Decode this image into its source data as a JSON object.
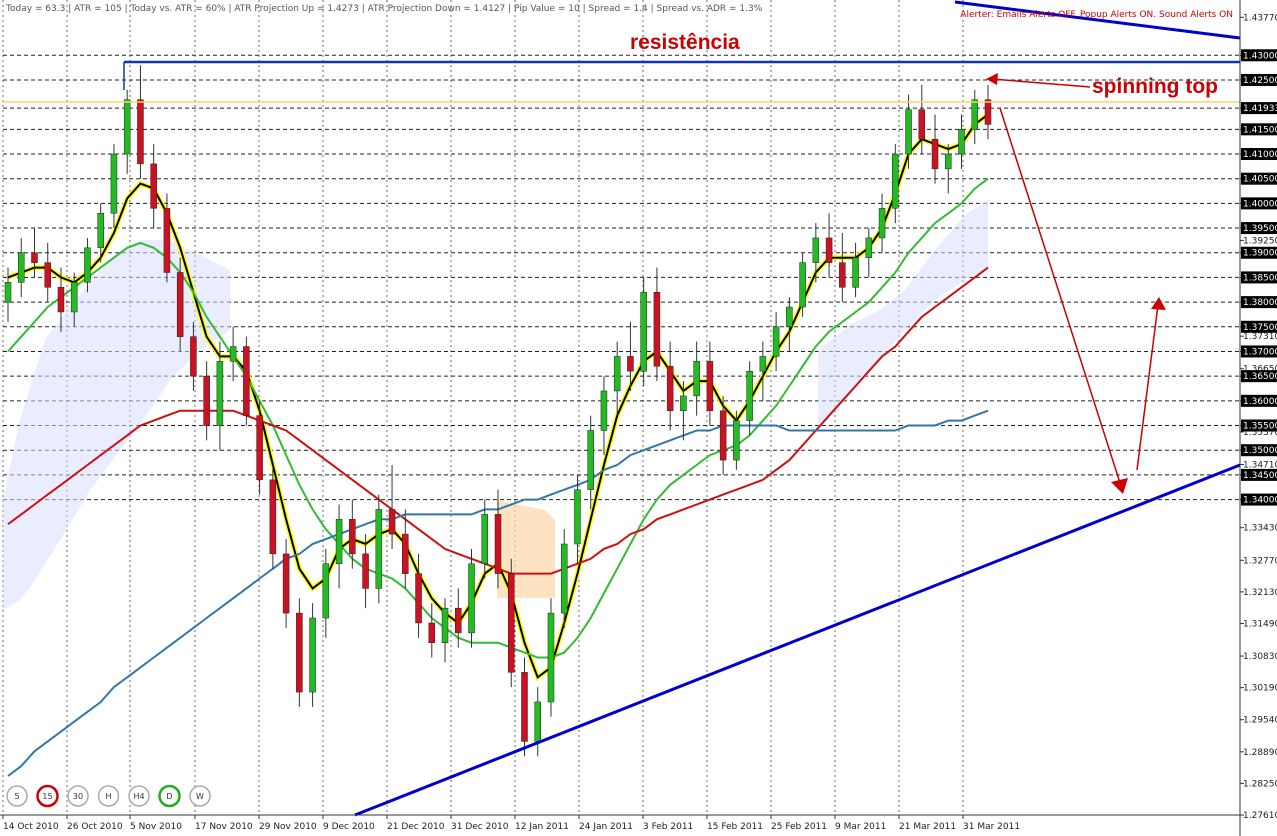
{
  "info_bar": {
    "items": [
      "Today = 63.3",
      "ATR = 105",
      "Today vs. ATR = 60%",
      "ATR Projection Up = 1.4273",
      "ATR Projection Down = 1.4127",
      "Pip Value = 10",
      "Spread = 1.4",
      "Spread vs. ADR = 1.3%"
    ],
    "alerter": "Alerter: Emails Alerts OFF. Popup Alerts ON. Sound Alerts ON"
  },
  "annotations": {
    "resistance": "resistência",
    "spinning_top": "spinning top"
  },
  "timeframes": [
    {
      "label": "5",
      "active": false
    },
    {
      "label": "15",
      "active": true,
      "color": "#cc0000"
    },
    {
      "label": "30",
      "active": false
    },
    {
      "label": "H",
      "active": false
    },
    {
      "label": "H4",
      "active": false
    },
    {
      "label": "D",
      "active": true,
      "color": "#22aa22"
    },
    {
      "label": "W",
      "active": false
    }
  ],
  "colors": {
    "bull": "#22bb22",
    "bear": "#cc1122",
    "ma_fast": "#000000",
    "ma_fast_band": "#ffff00",
    "ma_green": "#33bb33",
    "ma_red": "#cc1111",
    "ma_blue": "#3377aa",
    "trendline": "#0000cc",
    "arrow": "#cc0000",
    "resistance_line": "#1133bb",
    "price_line": "#f5d26e"
  },
  "chart_data": {
    "type": "candlestick",
    "symbol_pair": "EUR/USD",
    "timeframe": "D",
    "title": "",
    "ylim": [
      1.2761,
      1.4412
    ],
    "y_ticks": [
      1.4377,
      1.43,
      1.425,
      1.4193,
      1.415,
      1.41,
      1.405,
      1.4,
      1.395,
      1.3925,
      1.39,
      1.385,
      1.38,
      1.375,
      1.3731,
      1.37,
      1.3665,
      1.365,
      1.36,
      1.355,
      1.3537,
      1.35,
      1.3471,
      1.345,
      1.34,
      1.3343,
      1.3277,
      1.3213,
      1.3149,
      1.3083,
      1.3019,
      1.2954,
      1.2889,
      1.2825,
      1.2761
    ],
    "y_tick_labels": [
      "1.43770",
      "1.43000",
      "1.42500",
      "1.41933",
      "1.41500",
      "1.41000",
      "1.40500",
      "1.40000",
      "1.39500",
      "1.39250",
      "1.39000",
      "1.38500",
      "1.38000",
      "1.37500",
      "1.37310",
      "1.37000",
      "1.36650",
      "1.36500",
      "1.36000",
      "1.35500",
      "1.35370",
      "1.35000",
      "1.34710",
      "1.34500",
      "1.34000",
      "1.33430",
      "1.32770",
      "1.32130",
      "1.31490",
      "1.30830",
      "1.30190",
      "1.29540",
      "1.28890",
      "1.28250",
      "1.27610"
    ],
    "highlighted_levels": [
      "1.43000",
      "1.42500",
      "1.41933",
      "1.41500",
      "1.41000",
      "1.40500",
      "1.40000",
      "1.39500",
      "1.39000",
      "1.38500",
      "1.38000",
      "1.37500",
      "1.37000",
      "1.36500",
      "1.36000",
      "1.35500",
      "1.35000",
      "1.34500",
      "1.34000"
    ],
    "x_labels": [
      "14 Oct 2010",
      "26 Oct 2010",
      "5 Nov 2010",
      "17 Nov 2010",
      "29 Nov 2010",
      "9 Dec 2010",
      "21 Dec 2010",
      "31 Dec 2010",
      "12 Jan 2011",
      "24 Jan 2011",
      "3 Feb 2011",
      "15 Feb 2011",
      "25 Feb 2011",
      "9 Mar 2011",
      "21 Mar 2011",
      "31 Mar 2011"
    ],
    "resistance_level": 1.4285,
    "current_price": 1.41933,
    "candles": [
      [
        1.38,
        1.387,
        1.376,
        1.384
      ],
      [
        1.384,
        1.393,
        1.381,
        1.39
      ],
      [
        1.39,
        1.395,
        1.385,
        1.388
      ],
      [
        1.388,
        1.392,
        1.38,
        1.383
      ],
      [
        1.383,
        1.387,
        1.374,
        1.378
      ],
      [
        1.378,
        1.386,
        1.375,
        1.384
      ],
      [
        1.384,
        1.393,
        1.382,
        1.391
      ],
      [
        1.391,
        1.4,
        1.388,
        1.398
      ],
      [
        1.398,
        1.412,
        1.395,
        1.41
      ],
      [
        1.41,
        1.423,
        1.406,
        1.421
      ],
      [
        1.421,
        1.428,
        1.405,
        1.408
      ],
      [
        1.408,
        1.412,
        1.395,
        1.399
      ],
      [
        1.399,
        1.402,
        1.384,
        1.386
      ],
      [
        1.386,
        1.389,
        1.37,
        1.373
      ],
      [
        1.373,
        1.376,
        1.362,
        1.365
      ],
      [
        1.365,
        1.368,
        1.352,
        1.355
      ],
      [
        1.355,
        1.372,
        1.35,
        1.368
      ],
      [
        1.368,
        1.375,
        1.364,
        1.371
      ],
      [
        1.371,
        1.373,
        1.355,
        1.357
      ],
      [
        1.357,
        1.36,
        1.341,
        1.344
      ],
      [
        1.344,
        1.347,
        1.326,
        1.329
      ],
      [
        1.329,
        1.332,
        1.314,
        1.317
      ],
      [
        1.317,
        1.32,
        1.298,
        1.301
      ],
      [
        1.301,
        1.319,
        1.298,
        1.316
      ],
      [
        1.316,
        1.33,
        1.312,
        1.327
      ],
      [
        1.327,
        1.339,
        1.322,
        1.336
      ],
      [
        1.336,
        1.34,
        1.326,
        1.329
      ],
      [
        1.329,
        1.333,
        1.318,
        1.322
      ],
      [
        1.322,
        1.341,
        1.319,
        1.338
      ],
      [
        1.338,
        1.347,
        1.33,
        1.333
      ],
      [
        1.333,
        1.338,
        1.322,
        1.325
      ],
      [
        1.325,
        1.329,
        1.312,
        1.315
      ],
      [
        1.315,
        1.319,
        1.308,
        1.311
      ],
      [
        1.311,
        1.32,
        1.307,
        1.318
      ],
      [
        1.318,
        1.322,
        1.31,
        1.313
      ],
      [
        1.313,
        1.33,
        1.31,
        1.327
      ],
      [
        1.327,
        1.34,
        1.324,
        1.337
      ],
      [
        1.337,
        1.342,
        1.322,
        1.325
      ],
      [
        1.325,
        1.328,
        1.302,
        1.305
      ],
      [
        1.305,
        1.308,
        1.288,
        1.291
      ],
      [
        1.291,
        1.302,
        1.288,
        1.299
      ],
      [
        1.299,
        1.32,
        1.296,
        1.317
      ],
      [
        1.317,
        1.334,
        1.314,
        1.331
      ],
      [
        1.331,
        1.345,
        1.327,
        1.342
      ],
      [
        1.342,
        1.357,
        1.338,
        1.354
      ],
      [
        1.354,
        1.365,
        1.349,
        1.362
      ],
      [
        1.362,
        1.372,
        1.357,
        1.369
      ],
      [
        1.369,
        1.376,
        1.362,
        1.366
      ],
      [
        1.366,
        1.385,
        1.363,
        1.382
      ],
      [
        1.382,
        1.387,
        1.364,
        1.367
      ],
      [
        1.367,
        1.372,
        1.354,
        1.358
      ],
      [
        1.358,
        1.364,
        1.352,
        1.361
      ],
      [
        1.361,
        1.372,
        1.357,
        1.368
      ],
      [
        1.368,
        1.372,
        1.355,
        1.358
      ],
      [
        1.358,
        1.361,
        1.345,
        1.348
      ],
      [
        1.348,
        1.358,
        1.346,
        1.356
      ],
      [
        1.356,
        1.368,
        1.353,
        1.366
      ],
      [
        1.366,
        1.372,
        1.36,
        1.369
      ],
      [
        1.369,
        1.378,
        1.366,
        1.375
      ],
      [
        1.375,
        1.381,
        1.37,
        1.379
      ],
      [
        1.379,
        1.39,
        1.377,
        1.388
      ],
      [
        1.388,
        1.396,
        1.384,
        1.393
      ],
      [
        1.393,
        1.398,
        1.385,
        1.388
      ],
      [
        1.388,
        1.394,
        1.38,
        1.383
      ],
      [
        1.383,
        1.392,
        1.381,
        1.389
      ],
      [
        1.389,
        1.395,
        1.385,
        1.393
      ],
      [
        1.393,
        1.402,
        1.39,
        1.399
      ],
      [
        1.399,
        1.412,
        1.396,
        1.41
      ],
      [
        1.41,
        1.422,
        1.407,
        1.419
      ],
      [
        1.419,
        1.424,
        1.41,
        1.413
      ],
      [
        1.413,
        1.418,
        1.404,
        1.407
      ],
      [
        1.407,
        1.412,
        1.402,
        1.41
      ],
      [
        1.41,
        1.418,
        1.407,
        1.415
      ],
      [
        1.415,
        1.423,
        1.412,
        1.421
      ],
      [
        1.421,
        1.424,
        1.413,
        1.416
      ]
    ],
    "series": [
      {
        "name": "",
        "color": "#000000",
        "values": [
          1.385,
          1.386,
          1.387,
          1.387,
          1.385,
          1.384,
          1.386,
          1.389,
          1.394,
          1.401,
          1.404,
          1.403,
          1.398,
          1.391,
          1.382,
          1.373,
          1.369,
          1.369,
          1.366,
          1.358,
          1.347,
          1.336,
          1.326,
          1.322,
          1.324,
          1.33,
          1.332,
          1.331,
          1.333,
          1.334,
          1.331,
          1.325,
          1.32,
          1.317,
          1.315,
          1.319,
          1.325,
          1.327,
          1.321,
          1.311,
          1.304,
          1.306,
          1.315,
          1.325,
          1.336,
          1.347,
          1.357,
          1.363,
          1.368,
          1.37,
          1.366,
          1.362,
          1.364,
          1.364,
          1.359,
          1.356,
          1.36,
          1.365,
          1.37,
          1.374,
          1.38,
          1.386,
          1.389,
          1.389,
          1.389,
          1.391,
          1.395,
          1.402,
          1.41,
          1.413,
          1.412,
          1.411,
          1.412,
          1.416,
          1.418
        ]
      },
      {
        "name": "",
        "color": "#33bb33",
        "values": [
          1.37,
          1.373,
          1.376,
          1.379,
          1.381,
          1.383,
          1.385,
          1.387,
          1.389,
          1.391,
          1.392,
          1.391,
          1.389,
          1.386,
          1.382,
          1.377,
          1.373,
          1.369,
          1.365,
          1.36,
          1.355,
          1.349,
          1.343,
          1.338,
          1.334,
          1.331,
          1.328,
          1.326,
          1.325,
          1.324,
          1.322,
          1.319,
          1.316,
          1.314,
          1.312,
          1.311,
          1.311,
          1.311,
          1.31,
          1.309,
          1.308,
          1.308,
          1.309,
          1.312,
          1.316,
          1.321,
          1.326,
          1.331,
          1.336,
          1.34,
          1.343,
          1.345,
          1.347,
          1.349,
          1.35,
          1.351,
          1.353,
          1.356,
          1.359,
          1.363,
          1.367,
          1.371,
          1.374,
          1.376,
          1.378,
          1.38,
          1.383,
          1.386,
          1.39,
          1.393,
          1.396,
          1.398,
          1.4,
          1.403,
          1.405
        ]
      },
      {
        "name": "",
        "color": "#cc1111",
        "values": [
          1.335,
          1.337,
          1.339,
          1.341,
          1.343,
          1.345,
          1.347,
          1.349,
          1.351,
          1.353,
          1.355,
          1.356,
          1.357,
          1.358,
          1.358,
          1.358,
          1.358,
          1.358,
          1.357,
          1.356,
          1.355,
          1.354,
          1.352,
          1.35,
          1.348,
          1.346,
          1.344,
          1.342,
          1.34,
          1.338,
          1.336,
          1.334,
          1.332,
          1.33,
          1.329,
          1.328,
          1.327,
          1.326,
          1.325,
          1.325,
          1.325,
          1.325,
          1.326,
          1.327,
          1.328,
          1.33,
          1.331,
          1.333,
          1.334,
          1.336,
          1.337,
          1.338,
          1.339,
          1.34,
          1.341,
          1.342,
          1.343,
          1.344,
          1.346,
          1.348,
          1.351,
          1.354,
          1.357,
          1.36,
          1.363,
          1.366,
          1.369,
          1.371,
          1.374,
          1.377,
          1.379,
          1.381,
          1.383,
          1.385,
          1.387
        ]
      },
      {
        "name": "",
        "color": "#3377aa",
        "values": [
          1.284,
          1.286,
          1.289,
          1.291,
          1.293,
          1.295,
          1.297,
          1.299,
          1.302,
          1.304,
          1.306,
          1.308,
          1.31,
          1.312,
          1.314,
          1.316,
          1.318,
          1.32,
          1.322,
          1.324,
          1.326,
          1.328,
          1.329,
          1.331,
          1.332,
          1.333,
          1.334,
          1.335,
          1.336,
          1.336,
          1.337,
          1.337,
          1.337,
          1.337,
          1.337,
          1.337,
          1.338,
          1.338,
          1.339,
          1.34,
          1.34,
          1.341,
          1.342,
          1.343,
          1.344,
          1.346,
          1.347,
          1.349,
          1.35,
          1.351,
          1.352,
          1.353,
          1.354,
          1.354,
          1.355,
          1.355,
          1.355,
          1.355,
          1.355,
          1.354,
          1.354,
          1.354,
          1.354,
          1.354,
          1.354,
          1.354,
          1.354,
          1.354,
          1.355,
          1.355,
          1.355,
          1.356,
          1.356,
          1.357,
          1.358
        ]
      }
    ]
  }
}
